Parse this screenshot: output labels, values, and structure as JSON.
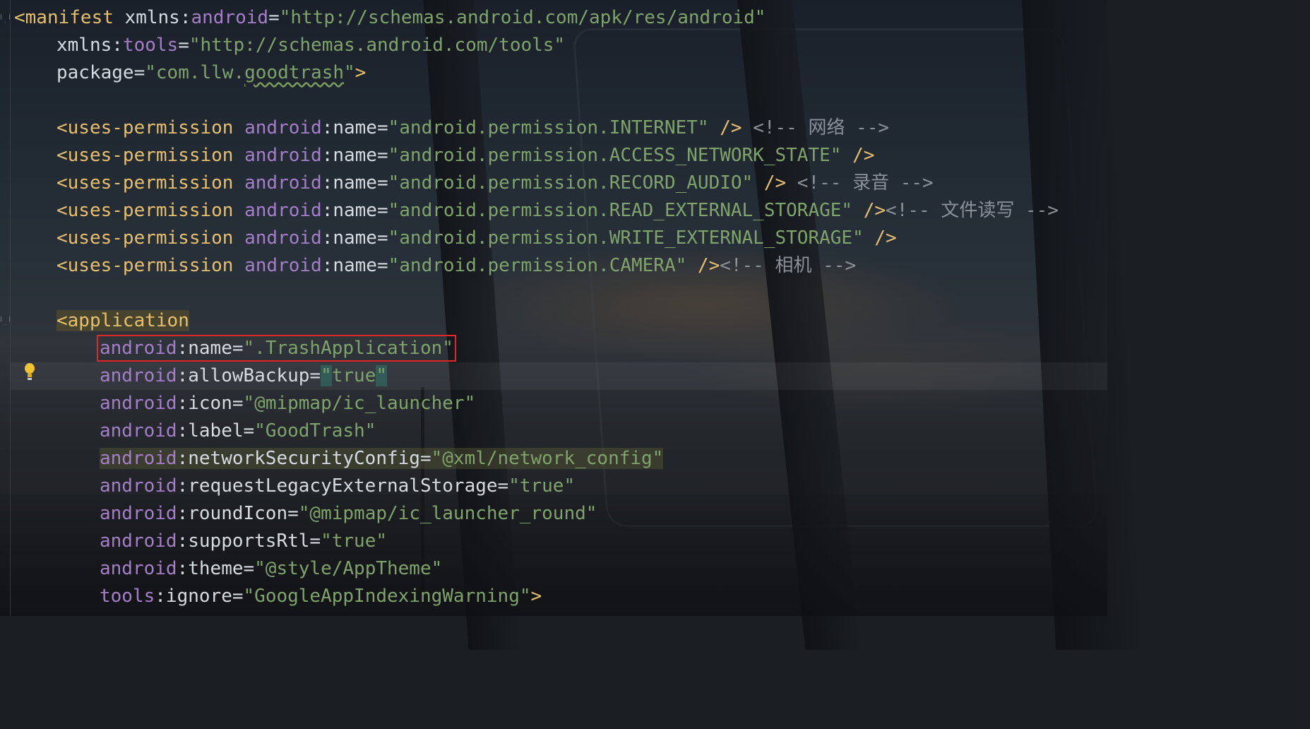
{
  "manifest": {
    "open": "<manifest",
    "xmlns_prefix": "xmlns",
    "xmlns_android_name": "android",
    "xmlns_android_value": "\"http://schemas.android.com/apk/res/android\"",
    "xmlns_tools_name": "tools",
    "xmlns_tools_value": "\"http://schemas.android.com/tools\"",
    "package_attr": "package",
    "package_value_prefix": "\"com.llw.",
    "package_value_squiggle": "goodtrash",
    "package_value_suffix": "\"",
    "close": ">"
  },
  "permissions": [
    {
      "value": "\"android.permission.INTERNET\"",
      "end": " />",
      "comment": " <!-- 网络 -->"
    },
    {
      "value": "\"android.permission.ACCESS_NETWORK_STATE\"",
      "end": " />",
      "comment": ""
    },
    {
      "value": "\"android.permission.RECORD_AUDIO\"",
      "end": " />",
      "comment": " <!-- 录音 -->"
    },
    {
      "value": "\"android.permission.READ_EXTERNAL_STORAGE\"",
      "end": " />",
      "comment": "<!-- 文件读写 -->"
    },
    {
      "value": "\"android.permission.WRITE_EXTERNAL_STORAGE\"",
      "end": " />",
      "comment": ""
    },
    {
      "value": "\"android.permission.CAMERA\"",
      "end": " />",
      "comment": "<!-- 相机 -->"
    }
  ],
  "permission_tag": "<uses-permission",
  "android_ns": "android",
  "name_attr": ":name",
  "equals": "=",
  "application": {
    "lt": "<",
    "tag": "application",
    "attrs": [
      {
        "ns": "android",
        "name": ":name",
        "value": "\".TrashApplication\""
      },
      {
        "ns": "android",
        "name": ":allowBackup",
        "q_open": "\"",
        "value_text": "true",
        "q_close": "\""
      },
      {
        "ns": "android",
        "name": ":icon",
        "value": "\"@mipmap/ic_launcher\""
      },
      {
        "ns": "android",
        "name": ":label",
        "value": "\"GoodTrash\""
      },
      {
        "ns": "android",
        "name": ":networkSecurityConfig",
        "value": "\"@xml/network_config\""
      },
      {
        "ns": "android",
        "name": ":requestLegacyExternalStorage",
        "value": "\"true\""
      },
      {
        "ns": "android",
        "name": ":roundIcon",
        "value": "\"@mipmap/ic_launcher_round\""
      },
      {
        "ns": "android",
        "name": ":supportsRtl",
        "value": "\"true\""
      },
      {
        "ns": "android",
        "name": ":theme",
        "value": "\"@style/AppTheme\""
      },
      {
        "ns": "tools",
        "name": ":ignore",
        "value": "\"GoogleAppIndexingWarning\"",
        "end": ">"
      }
    ]
  },
  "icons": {
    "intention_bulb": "lightbulb-icon",
    "fold": "fold-marker-icon"
  },
  "colors": {
    "tag": "#e8bf6a",
    "namespace": "#a57ec9",
    "string": "#7fa36a",
    "comment": "#8b9198",
    "highlight_box": "#e02828"
  }
}
